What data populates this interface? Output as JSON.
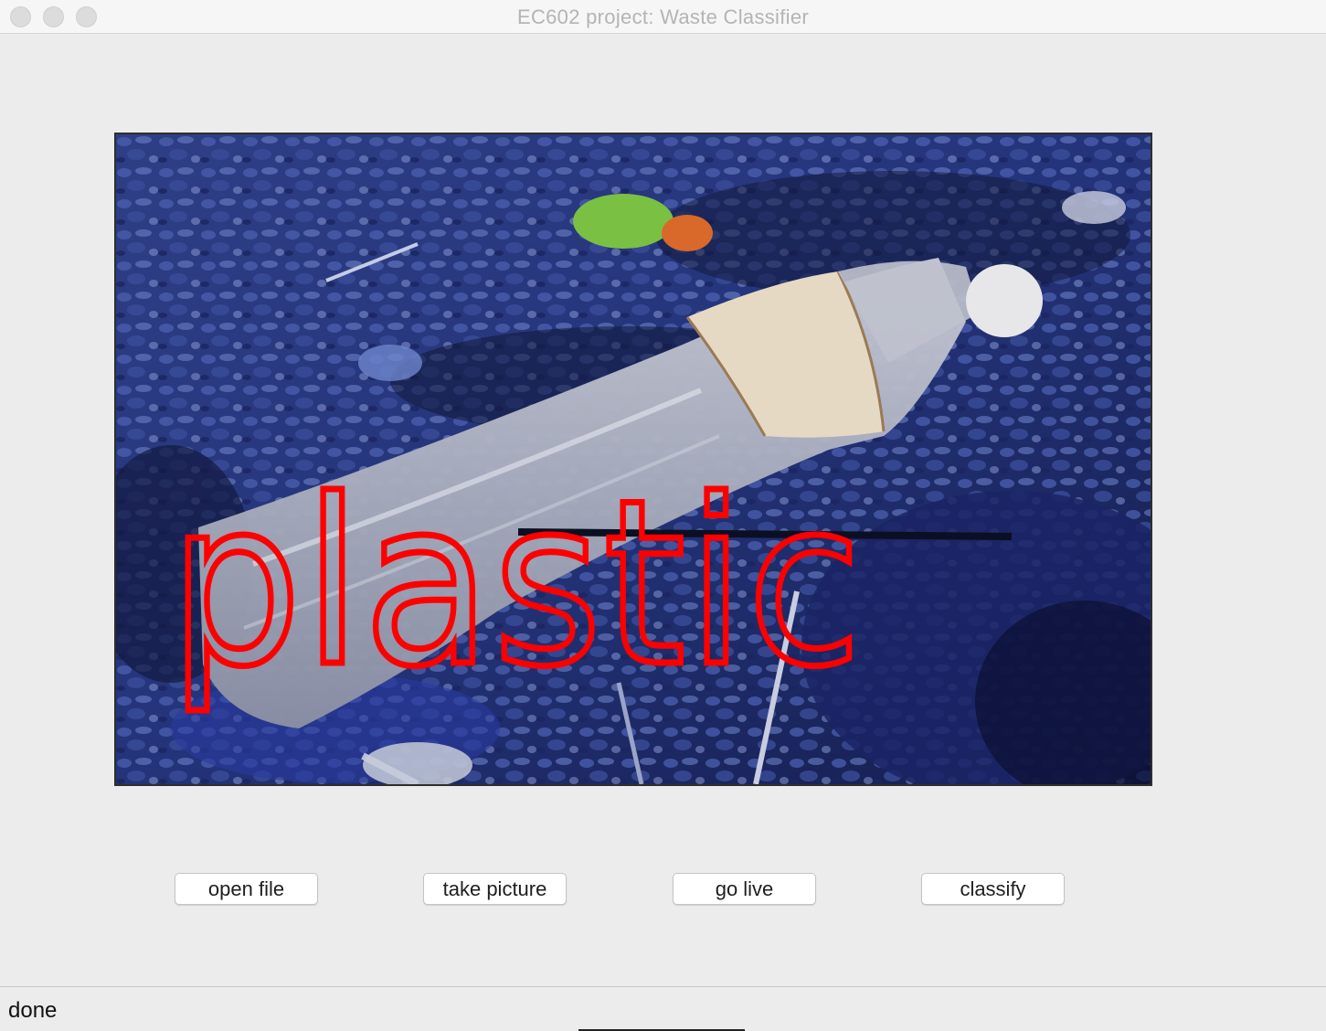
{
  "window": {
    "title": "EC602 project: Waste Classifier"
  },
  "image": {
    "overlay_label": "plastic",
    "overlay_color": "#ff0000"
  },
  "buttons": {
    "open_file": "open file",
    "take_picture": "take picture",
    "go_live": "go live",
    "classify": "classify"
  },
  "status": {
    "text": "done"
  }
}
